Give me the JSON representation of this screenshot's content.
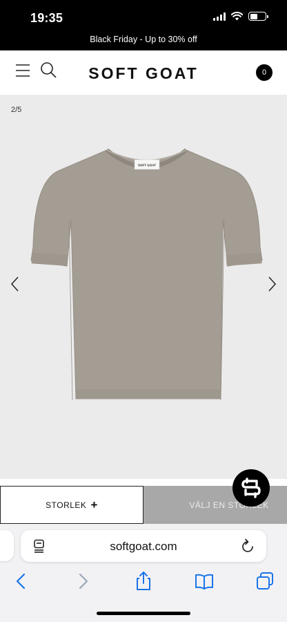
{
  "status_bar": {
    "time": "19:35",
    "battery_level": 0.5
  },
  "promo": {
    "text": "Black Friday - Up to 30% off"
  },
  "header": {
    "brand": "SOFT GOAT",
    "cart_count": "0",
    "icons": [
      "menu-icon",
      "search-icon"
    ]
  },
  "gallery": {
    "counter": "2/5",
    "label_on_garment": "SOFT GOAT",
    "icons": [
      "chevron-left-icon",
      "chevron-right-icon"
    ]
  },
  "actions": {
    "size_label": "STORLEK",
    "size_plus": "+",
    "choose_label": "VÄLJ EN STORLEK"
  },
  "browser": {
    "url": "softgoat.com",
    "icons": [
      "reader-icon",
      "reload-icon",
      "back-icon",
      "forward-icon",
      "share-icon",
      "bookmarks-icon",
      "tabs-icon"
    ]
  },
  "colors": {
    "accent": "#000000",
    "gallery_bg": "#ebebeb",
    "garment": "#a49d94",
    "disabled_button": "#a8a8a8",
    "browser_blue": "#1a73e8"
  }
}
